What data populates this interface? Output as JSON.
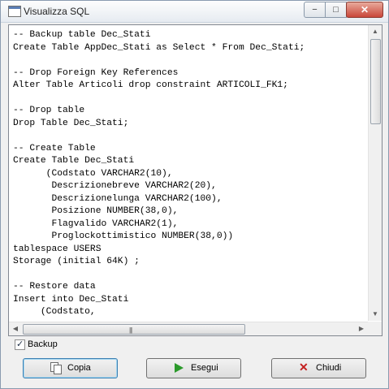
{
  "window": {
    "title": "Visualizza SQL"
  },
  "editor": {
    "lines": [
      "-- Backup table Dec_Stati",
      "Create Table AppDec_Stati as Select * From Dec_Stati;",
      "",
      "-- Drop Foreign Key References",
      "Alter Table Articoli drop constraint ARTICOLI_FK1;",
      "",
      "-- Drop table",
      "Drop Table Dec_Stati;",
      "",
      "-- Create Table",
      "Create Table Dec_Stati",
      "      (Codstato VARCHAR2(10),",
      "       Descrizionebreve VARCHAR2(20),",
      "       Descrizionelunga VARCHAR2(100),",
      "       Posizione NUMBER(38,0),",
      "       Flagvalido VARCHAR2(1),",
      "       Proglockottimistico NUMBER(38,0))",
      "tablespace USERS",
      "Storage (initial 64K) ;",
      "",
      "-- Restore data",
      "Insert into Dec_Stati",
      "     (Codstato,"
    ]
  },
  "backup": {
    "label": "Backup",
    "checked": true
  },
  "buttons": {
    "copia": "Copia",
    "esegui": "Esegui",
    "chiudi": "Chiudi"
  },
  "titlebar_controls": {
    "minimize": "−",
    "maximize": "□",
    "close": "✕"
  }
}
